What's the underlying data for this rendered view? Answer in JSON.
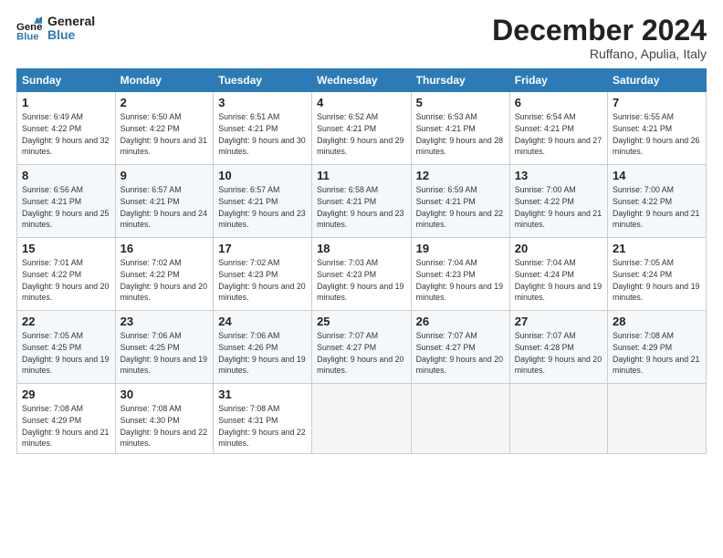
{
  "header": {
    "logo_line1": "General",
    "logo_line2": "Blue",
    "month": "December 2024",
    "location": "Ruffano, Apulia, Italy"
  },
  "weekdays": [
    "Sunday",
    "Monday",
    "Tuesday",
    "Wednesday",
    "Thursday",
    "Friday",
    "Saturday"
  ],
  "weeks": [
    [
      {
        "day": "1",
        "sunrise": "6:49 AM",
        "sunset": "4:22 PM",
        "daylight": "9 hours and 32 minutes."
      },
      {
        "day": "2",
        "sunrise": "6:50 AM",
        "sunset": "4:22 PM",
        "daylight": "9 hours and 31 minutes."
      },
      {
        "day": "3",
        "sunrise": "6:51 AM",
        "sunset": "4:21 PM",
        "daylight": "9 hours and 30 minutes."
      },
      {
        "day": "4",
        "sunrise": "6:52 AM",
        "sunset": "4:21 PM",
        "daylight": "9 hours and 29 minutes."
      },
      {
        "day": "5",
        "sunrise": "6:53 AM",
        "sunset": "4:21 PM",
        "daylight": "9 hours and 28 minutes."
      },
      {
        "day": "6",
        "sunrise": "6:54 AM",
        "sunset": "4:21 PM",
        "daylight": "9 hours and 27 minutes."
      },
      {
        "day": "7",
        "sunrise": "6:55 AM",
        "sunset": "4:21 PM",
        "daylight": "9 hours and 26 minutes."
      }
    ],
    [
      {
        "day": "8",
        "sunrise": "6:56 AM",
        "sunset": "4:21 PM",
        "daylight": "9 hours and 25 minutes."
      },
      {
        "day": "9",
        "sunrise": "6:57 AM",
        "sunset": "4:21 PM",
        "daylight": "9 hours and 24 minutes."
      },
      {
        "day": "10",
        "sunrise": "6:57 AM",
        "sunset": "4:21 PM",
        "daylight": "9 hours and 23 minutes."
      },
      {
        "day": "11",
        "sunrise": "6:58 AM",
        "sunset": "4:21 PM",
        "daylight": "9 hours and 23 minutes."
      },
      {
        "day": "12",
        "sunrise": "6:59 AM",
        "sunset": "4:21 PM",
        "daylight": "9 hours and 22 minutes."
      },
      {
        "day": "13",
        "sunrise": "7:00 AM",
        "sunset": "4:22 PM",
        "daylight": "9 hours and 21 minutes."
      },
      {
        "day": "14",
        "sunrise": "7:00 AM",
        "sunset": "4:22 PM",
        "daylight": "9 hours and 21 minutes."
      }
    ],
    [
      {
        "day": "15",
        "sunrise": "7:01 AM",
        "sunset": "4:22 PM",
        "daylight": "9 hours and 20 minutes."
      },
      {
        "day": "16",
        "sunrise": "7:02 AM",
        "sunset": "4:22 PM",
        "daylight": "9 hours and 20 minutes."
      },
      {
        "day": "17",
        "sunrise": "7:02 AM",
        "sunset": "4:23 PM",
        "daylight": "9 hours and 20 minutes."
      },
      {
        "day": "18",
        "sunrise": "7:03 AM",
        "sunset": "4:23 PM",
        "daylight": "9 hours and 19 minutes."
      },
      {
        "day": "19",
        "sunrise": "7:04 AM",
        "sunset": "4:23 PM",
        "daylight": "9 hours and 19 minutes."
      },
      {
        "day": "20",
        "sunrise": "7:04 AM",
        "sunset": "4:24 PM",
        "daylight": "9 hours and 19 minutes."
      },
      {
        "day": "21",
        "sunrise": "7:05 AM",
        "sunset": "4:24 PM",
        "daylight": "9 hours and 19 minutes."
      }
    ],
    [
      {
        "day": "22",
        "sunrise": "7:05 AM",
        "sunset": "4:25 PM",
        "daylight": "9 hours and 19 minutes."
      },
      {
        "day": "23",
        "sunrise": "7:06 AM",
        "sunset": "4:25 PM",
        "daylight": "9 hours and 19 minutes."
      },
      {
        "day": "24",
        "sunrise": "7:06 AM",
        "sunset": "4:26 PM",
        "daylight": "9 hours and 19 minutes."
      },
      {
        "day": "25",
        "sunrise": "7:07 AM",
        "sunset": "4:27 PM",
        "daylight": "9 hours and 20 minutes."
      },
      {
        "day": "26",
        "sunrise": "7:07 AM",
        "sunset": "4:27 PM",
        "daylight": "9 hours and 20 minutes."
      },
      {
        "day": "27",
        "sunrise": "7:07 AM",
        "sunset": "4:28 PM",
        "daylight": "9 hours and 20 minutes."
      },
      {
        "day": "28",
        "sunrise": "7:08 AM",
        "sunset": "4:29 PM",
        "daylight": "9 hours and 21 minutes."
      }
    ],
    [
      {
        "day": "29",
        "sunrise": "7:08 AM",
        "sunset": "4:29 PM",
        "daylight": "9 hours and 21 minutes."
      },
      {
        "day": "30",
        "sunrise": "7:08 AM",
        "sunset": "4:30 PM",
        "daylight": "9 hours and 22 minutes."
      },
      {
        "day": "31",
        "sunrise": "7:08 AM",
        "sunset": "4:31 PM",
        "daylight": "9 hours and 22 minutes."
      },
      null,
      null,
      null,
      null
    ]
  ],
  "labels": {
    "sunrise": "Sunrise:",
    "sunset": "Sunset:",
    "daylight": "Daylight:"
  }
}
